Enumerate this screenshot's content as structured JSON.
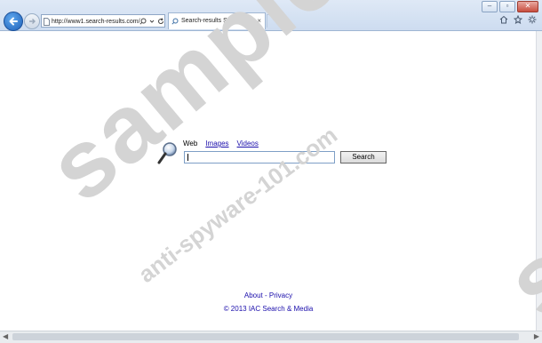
{
  "browser": {
    "address_url": "http://www1.search-results.com/",
    "tab_title": "Search-results Search",
    "tab_close": "×",
    "window_controls": {
      "minimize": "–",
      "restore": "▫",
      "close": "✕"
    }
  },
  "search": {
    "tabs": {
      "web": "Web",
      "images": "Images",
      "videos": "Videos"
    },
    "input_value": "",
    "button_label": "Search"
  },
  "footer": {
    "links": "About - Privacy",
    "copyright": "© 2013 IAC Search & Media"
  },
  "watermark": {
    "big_word": "sample",
    "url_text": "anti-spyware-101.com",
    "right_word": "sa"
  },
  "colors": {
    "link": "#1a0dab",
    "back_button": "#1d5fb8",
    "close_button": "#c84e3f",
    "watermark": "#d4d4d4"
  }
}
